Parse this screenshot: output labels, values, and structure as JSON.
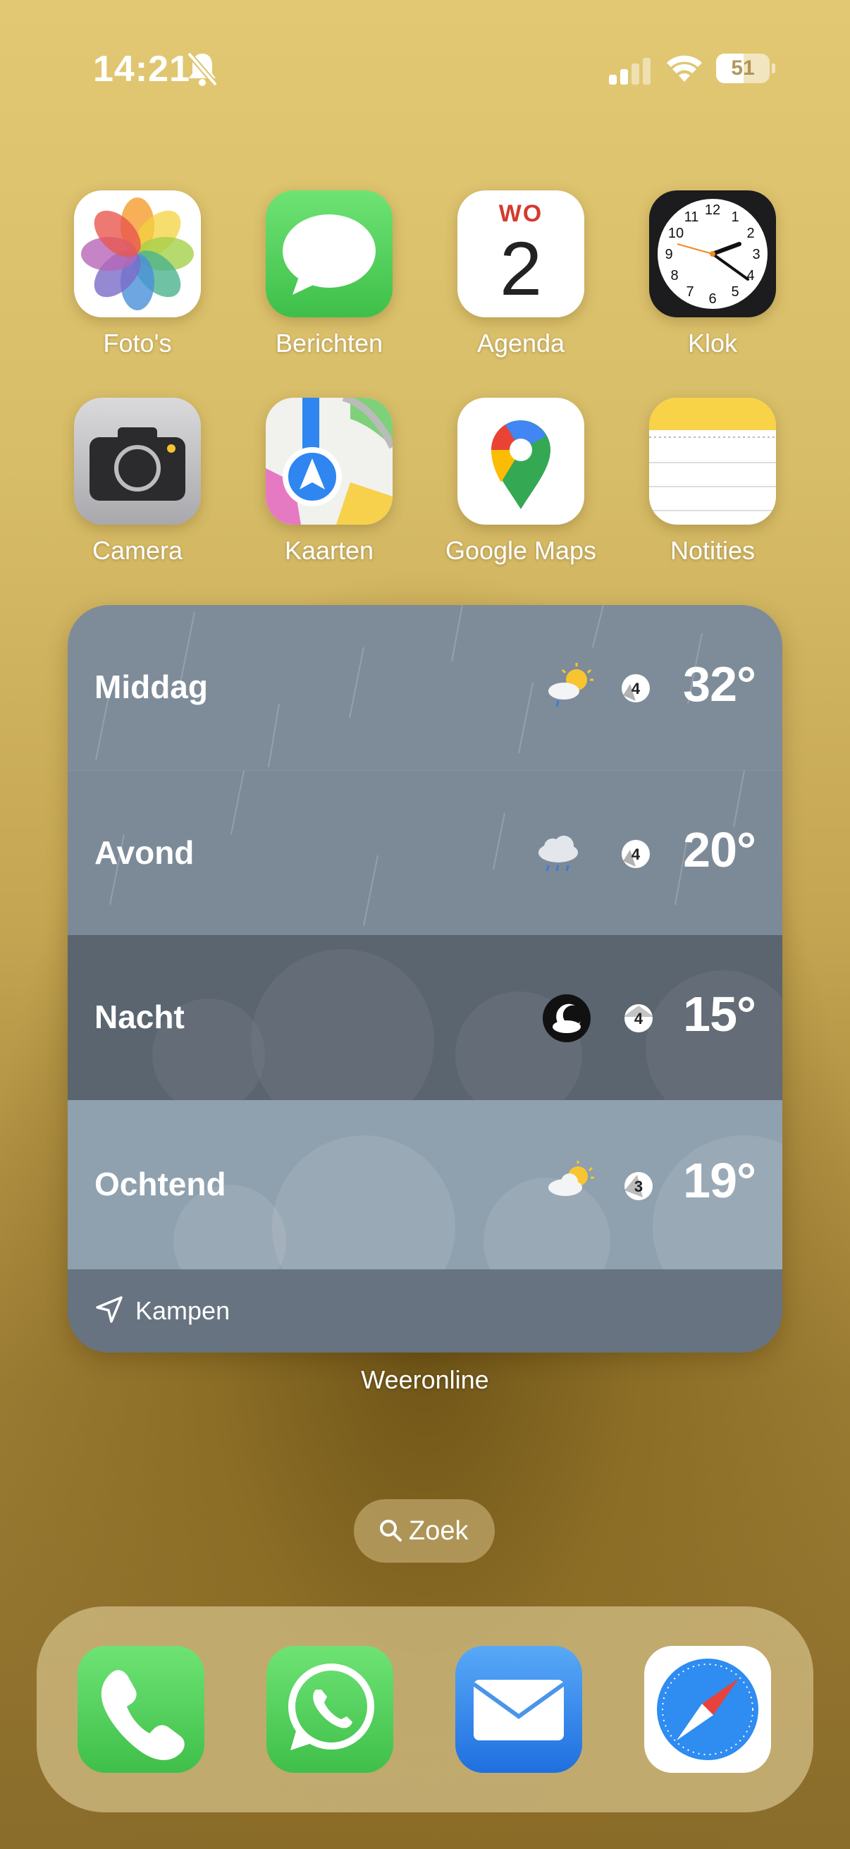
{
  "status_bar": {
    "time": "14:21",
    "battery_level": "51",
    "battery_fraction": 0.51,
    "icons": [
      "bell-slash-icon",
      "cellular-signal-icon",
      "wifi-icon",
      "battery-icon"
    ]
  },
  "apps": [
    {
      "label": "Foto's",
      "icon": "photos-icon"
    },
    {
      "label": "Berichten",
      "icon": "messages-icon"
    },
    {
      "label": "Agenda",
      "icon": "calendar-icon",
      "weekday": "WO",
      "day": "2"
    },
    {
      "label": "Klok",
      "icon": "clock-icon"
    },
    {
      "label": "Camera",
      "icon": "camera-icon"
    },
    {
      "label": "Kaarten",
      "icon": "maps-icon"
    },
    {
      "label": "Google Maps",
      "icon": "google-maps-icon"
    },
    {
      "label": "Notities",
      "icon": "notes-icon"
    }
  ],
  "weather_widget": {
    "rows": [
      {
        "period": "Middag",
        "temp": "32°",
        "condition": "sun-cloud-rain-icon",
        "wind": "4"
      },
      {
        "period": "Avond",
        "temp": "20°",
        "condition": "rain-cloud-icon",
        "wind": "4"
      },
      {
        "period": "Nacht",
        "temp": "15°",
        "condition": "moon-cloud-icon",
        "wind": "4"
      },
      {
        "period": "Ochtend",
        "temp": "19°",
        "condition": "sun-cloud-icon",
        "wind": "3"
      }
    ],
    "location": "Kampen",
    "app_name": "Weeronline"
  },
  "search": {
    "label": "Zoek"
  },
  "dock": [
    {
      "icon": "phone-icon"
    },
    {
      "icon": "whatsapp-icon"
    },
    {
      "icon": "mail-icon"
    },
    {
      "icon": "safari-icon"
    }
  ],
  "colors": {
    "calendar_weekday": "#d33b2f",
    "messages_green": "#5dd066",
    "mail_blue": "#2f86f0",
    "widget_rain": "#7e8c99",
    "widget_night": "#5b6570",
    "widget_morning": "#8fa0ae"
  }
}
